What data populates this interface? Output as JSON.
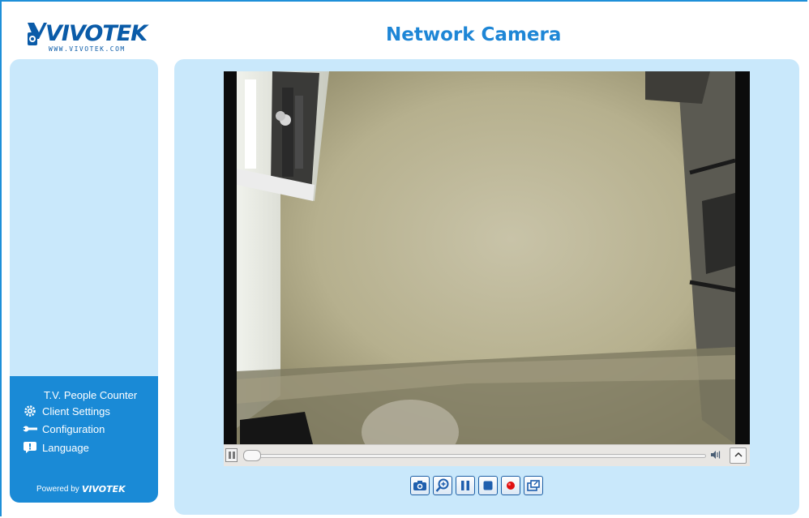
{
  "header": {
    "brand": "VIVOTEK",
    "brand_url": "WWW.VIVOTEK.COM",
    "page_title": "Network Camera"
  },
  "sidebar": {
    "menu_title": "T.V. People Counter",
    "items": [
      {
        "label": "Client Settings",
        "icon": "gear-icon"
      },
      {
        "label": "Configuration",
        "icon": "wrench-icon"
      },
      {
        "label": "Language",
        "icon": "speech-bubble-icon"
      }
    ],
    "powered_by_text": "Powered by",
    "powered_by_brand": "VIVOTEK"
  },
  "player": {
    "volume_icon": "volume-icon",
    "expand_icon": "chevron-up-icon"
  },
  "toolbar": {
    "buttons": [
      {
        "name": "snapshot",
        "icon": "camera-icon"
      },
      {
        "name": "digital-zoom",
        "icon": "zoom-in-icon"
      },
      {
        "name": "pause",
        "icon": "pause-icon"
      },
      {
        "name": "stop",
        "icon": "stop-icon"
      },
      {
        "name": "record",
        "icon": "record-icon"
      },
      {
        "name": "fullscreen",
        "icon": "fullscreen-icon"
      }
    ]
  },
  "colors": {
    "accent": "#1e86d6",
    "sidebar_menu_bg": "#1a8ad6",
    "panel_bg": "#c9e8fb",
    "record": "#e01010"
  }
}
